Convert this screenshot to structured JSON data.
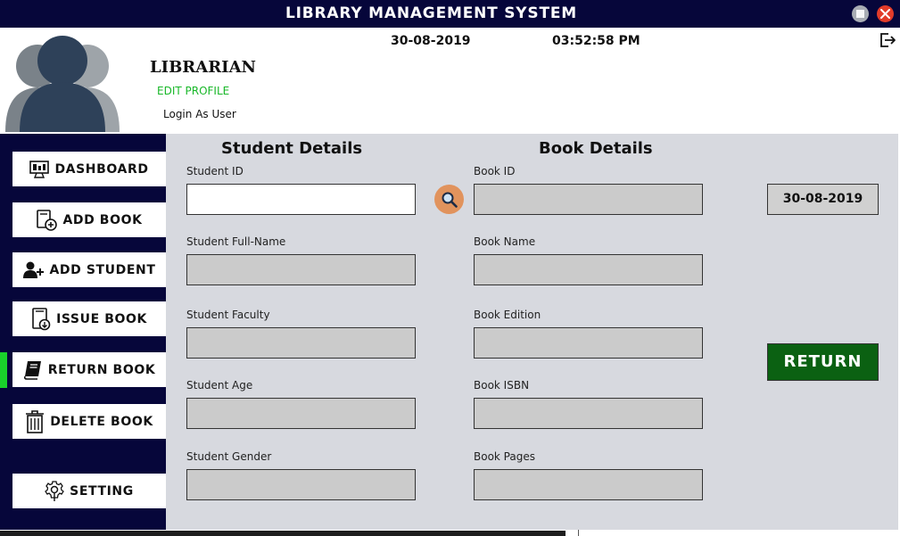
{
  "window": {
    "title": "LIBRARY MANAGEMENT SYSTEM"
  },
  "header": {
    "role": "LIBRARIAN",
    "edit_profile": "EDIT PROFILE",
    "login_as": "Login As User",
    "date": "30-08-2019",
    "time": "03:52:58 PM"
  },
  "sidebar": {
    "items": [
      {
        "label": "DASHBOARD",
        "icon": "dashboard-monitor-icon"
      },
      {
        "label": "ADD BOOK",
        "icon": "add-book-icon"
      },
      {
        "label": "ADD STUDENT",
        "icon": "add-user-icon"
      },
      {
        "label": "ISSUE BOOK",
        "icon": "issue-book-icon"
      },
      {
        "label": "RETURN BOOK",
        "icon": "book-icon"
      },
      {
        "label": "DELETE BOOK",
        "icon": "trash-icon"
      },
      {
        "label": "SETTING",
        "icon": "gear-icon"
      }
    ],
    "active_item": "RETURN BOOK"
  },
  "student": {
    "heading": "Student Details",
    "id_label": "Student ID",
    "id_value": "",
    "name_label": "Student Full-Name",
    "faculty_label": "Student Faculty",
    "age_label": "Student Age",
    "gender_label": "Student Gender"
  },
  "book": {
    "heading": "Book Details",
    "id_label": "Book ID",
    "name_label": "Book Name",
    "edition_label": "Book Edition",
    "isbn_label": "Book ISBN",
    "pages_label": "Book Pages"
  },
  "actions": {
    "return_date": "30-08-2019",
    "return_label": "RETURN"
  },
  "colors": {
    "navy": "#06063a",
    "active_green": "#19d12b",
    "edit_green": "#19b829",
    "return_green": "#0b6112",
    "search_orange": "#e1935d",
    "content_bg": "#d7d9df"
  }
}
